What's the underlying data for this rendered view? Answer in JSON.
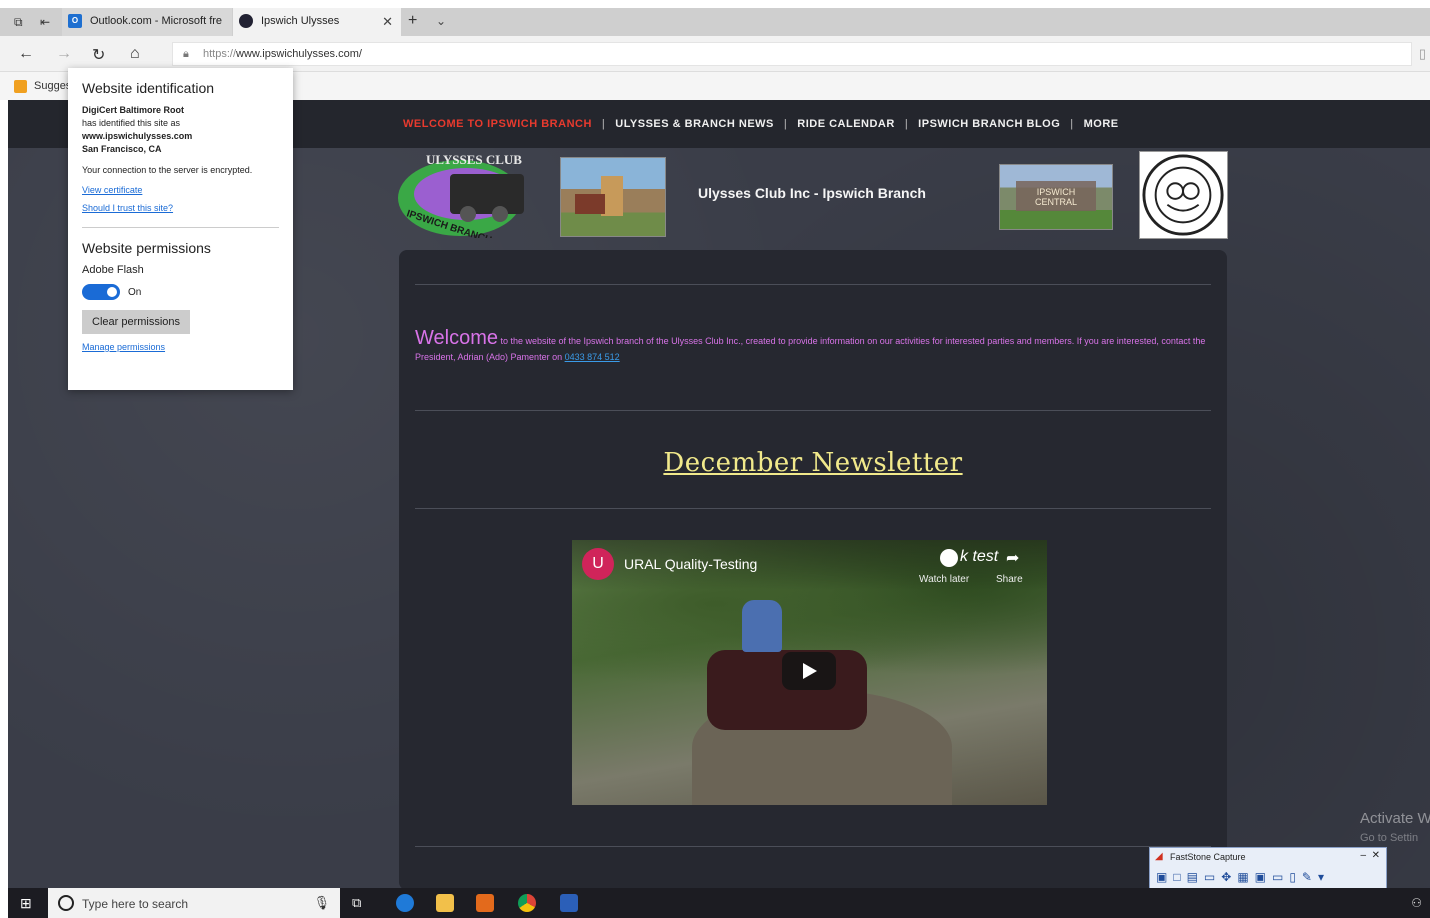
{
  "browser": {
    "tabs": [
      {
        "label": "Outlook.com - Microsoft fre"
      },
      {
        "label": "Ipswich Ulysses"
      }
    ],
    "address": {
      "protocol": "https://",
      "url": "www.ipswichulysses.com/"
    },
    "favorites": {
      "item": "Sugges"
    }
  },
  "site": {
    "nav": [
      "WELCOME TO IPSWICH BRANCH",
      "ULYSSES & BRANCH NEWS",
      "RIDE CALENDAR",
      "IPSWICH BRANCH BLOG",
      "MORE"
    ],
    "title": "Ulysses Club Inc - Ipswich Branch",
    "logo_text": {
      "top": "ULYSSES CLUB",
      "bottom": "IPSWICH BRANCH"
    },
    "sign_text": "IPSWICH CENTRAL",
    "welcome": {
      "lead": "Welcome",
      "body": " to the website of the Ipswich branch of the Ulysses Club Inc., created to provide information on our activities for interested parties and members.  If you are interested, contact the President, Adrian (Ado) Pamenter on ",
      "phone": "0433 874 512"
    },
    "newsletter": "December Newsletter",
    "video": {
      "avatar": "U",
      "title": "URAL Quality-Testing",
      "overlay": "k test",
      "watch_later": "Watch later",
      "share": "Share"
    }
  },
  "identity_popup": {
    "title": "Website identification",
    "issuer": "DigiCert Baltimore Root",
    "identified_line": "has identified this site as",
    "domain": "www.ipswichulysses.com",
    "location": "San Francisco, CA",
    "encrypted": "Your connection to the server is encrypted.",
    "view_cert": "View certificate",
    "trust_link": "Should I trust this site?",
    "permissions_title": "Website permissions",
    "flash_label": "Adobe Flash",
    "toggle_state": "On",
    "clear_button": "Clear permissions",
    "manage_link": "Manage permissions"
  },
  "watermark": {
    "line1": "Activate W",
    "line2": "Go to Settin"
  },
  "faststone": {
    "title": "FastStone Capture"
  },
  "taskbar": {
    "search_placeholder": "Type here to search"
  }
}
